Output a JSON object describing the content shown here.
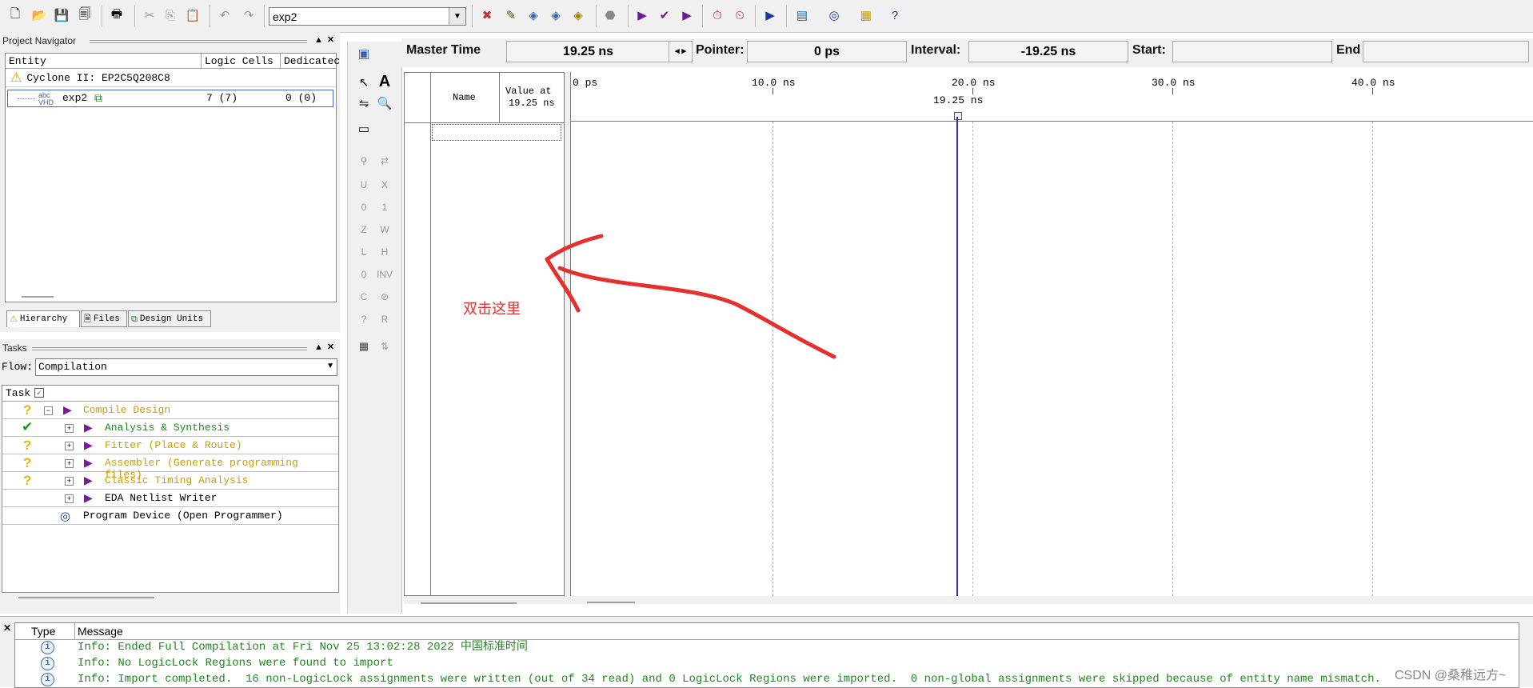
{
  "toolbar": {
    "project_value": "exp2",
    "icons": [
      "new-file-icon",
      "open-folder-icon",
      "save-icon",
      "save-all-icon",
      "print-icon",
      "cut-icon",
      "copy-icon",
      "paste-icon",
      "undo-icon",
      "redo-icon",
      "stop-compile-icon",
      "assign-icon",
      "compile-analysis-icon",
      "compile-fitter-icon",
      "compile-assembler-icon",
      "stop-icon",
      "start-compilation-icon",
      "start-analysis-icon",
      "start-timing-icon",
      "timing-analyzer-icon",
      "timing-clock-icon",
      "start-simulation-icon",
      "simulation-report-icon",
      "programmer-icon",
      "chip-planner-icon",
      "help-icon"
    ]
  },
  "project_navigator": {
    "title": "Project Navigator",
    "columns": [
      "Entity",
      "Logic Cells",
      "Dedicatec"
    ],
    "rows": [
      {
        "entity": "Cyclone II: EP2C5Q208C8",
        "logic_cells": "",
        "dedicated": ""
      },
      {
        "entity": "exp2",
        "logic_cells": "7 (7)",
        "dedicated": "0 (0)"
      }
    ],
    "tabs": [
      "Hierarchy",
      "Files",
      "Design Units"
    ]
  },
  "tasks": {
    "title": "Tasks",
    "flow_label": "Flow:",
    "flow_value": "Compilation",
    "task_header": "Task",
    "items": [
      {
        "label": "Compile Design",
        "status": "?",
        "color": "#c8a000"
      },
      {
        "label": "Analysis & Synthesis",
        "status": "✔",
        "color": "#1a8a1a"
      },
      {
        "label": "Fitter (Place & Route)",
        "status": "?",
        "color": "#c8a000"
      },
      {
        "label": "Assembler (Generate programming files)",
        "status": "?",
        "color": "#c8a000"
      },
      {
        "label": "Classic Timing Analysis",
        "status": "?",
        "color": "#c8a000"
      },
      {
        "label": "EDA Netlist Writer",
        "status": "",
        "color": "#000000"
      },
      {
        "label": "Program Device (Open Programmer)",
        "status": "",
        "color": "#000000"
      }
    ]
  },
  "waveform": {
    "master_time_label": "Master Time",
    "master_time_value": "19.25 ns",
    "pointer_label": "Pointer:",
    "pointer_value": "0 ps",
    "interval_label": "Interval:",
    "interval_value": "-19.25 ns",
    "start_label": "Start:",
    "start_value": "",
    "end_label": "End",
    "end_value": "",
    "name_header": "Name",
    "value_header_1": "Value at",
    "value_header_2": "19.25 ns",
    "time_ticks": [
      "0 ps",
      "10.0 ns",
      "20.0 ns",
      "30.0 ns",
      "40.0 ns"
    ],
    "cursor_label": "19.25 ns",
    "annotation": "双击这里"
  },
  "messages": {
    "columns": [
      "Type",
      "Message"
    ],
    "rows": [
      "Info: Ended Full Compilation at Fri Nov 25 13:02:28 2022 中国标准时间",
      "Info: No LogicLock Regions were found to import",
      "Info: Import completed.  16 non-LogicLock assignments were written (out of 34 read) and 0 LogicLock Regions were imported.  0 non-global assignments were skipped because of entity name mismatch."
    ]
  },
  "watermark": "CSDN @桑稚远方~",
  "colors": {
    "accent_red": "#e53030",
    "cursor_blue": "#3030b0",
    "info_green": "#1a8a1a",
    "warn_yellow": "#c8a000"
  }
}
